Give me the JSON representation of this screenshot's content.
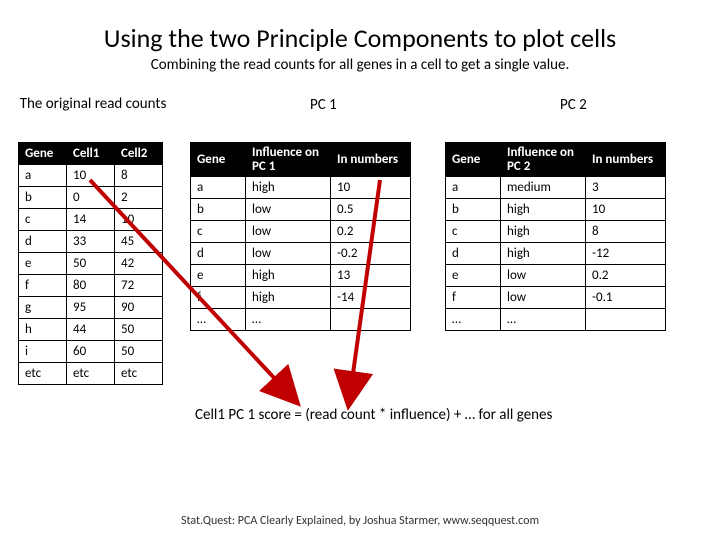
{
  "title": "Using the two Principle Components to plot cells",
  "subtitle": "Combining the read counts for all genes in a cell to get a single value.",
  "labels": {
    "original": "The original read counts",
    "pc1": "PC 1",
    "pc2": "PC 2"
  },
  "original_table": {
    "headers": [
      "Gene",
      "Cell1",
      "Cell2"
    ],
    "rows": [
      [
        "a",
        "10",
        "8"
      ],
      [
        "b",
        "0",
        "2"
      ],
      [
        "c",
        "14",
        "10"
      ],
      [
        "d",
        "33",
        "45"
      ],
      [
        "e",
        "50",
        "42"
      ],
      [
        "f",
        "80",
        "72"
      ],
      [
        "g",
        "95",
        "90"
      ],
      [
        "h",
        "44",
        "50"
      ],
      [
        "i",
        "60",
        "50"
      ],
      [
        "etc",
        "etc",
        "etc"
      ]
    ]
  },
  "pc1_table": {
    "headers": [
      "Gene",
      "Influence on PC 1",
      "In numbers"
    ],
    "rows": [
      [
        "a",
        "high",
        "10"
      ],
      [
        "b",
        "low",
        "0.5"
      ],
      [
        "c",
        "low",
        "0.2"
      ],
      [
        "d",
        "low",
        "-0.2"
      ],
      [
        "e",
        "high",
        "13"
      ],
      [
        "f",
        "high",
        "-14"
      ],
      [
        "…",
        "…",
        ""
      ]
    ]
  },
  "pc2_table": {
    "headers": [
      "Gene",
      "Influence on PC 2",
      "In numbers"
    ],
    "rows": [
      [
        "a",
        "medium",
        "3"
      ],
      [
        "b",
        "high",
        "10"
      ],
      [
        "c",
        "high",
        "8"
      ],
      [
        "d",
        "high",
        "-12"
      ],
      [
        "e",
        "low",
        "0.2"
      ],
      [
        "f",
        "low",
        "-0.1"
      ],
      [
        "…",
        "…",
        ""
      ]
    ]
  },
  "formula": "Cell1 PC 1 score = (read count * influence) + … for all genes",
  "footer": "Stat.Quest: PCA Clearly Explained, by Joshua Starmer, www.seqquest.com"
}
